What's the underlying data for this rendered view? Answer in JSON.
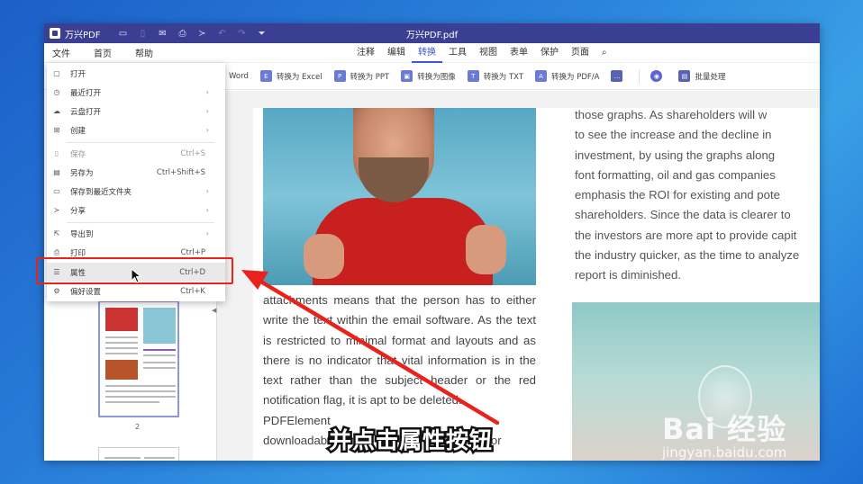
{
  "window": {
    "app_name": "万兴PDF",
    "doc_title": "万兴PDF.pdf"
  },
  "menubar": {
    "left": [
      "文件",
      "首页",
      "帮助"
    ],
    "right": [
      "注释",
      "编辑",
      "转换",
      "工具",
      "视图",
      "表单",
      "保护",
      "页面"
    ],
    "active": "转换"
  },
  "toolbar": {
    "items": [
      {
        "label": "Word",
        "icon": "word-icon"
      },
      {
        "label": "转换为 Excel",
        "icon": "excel-icon"
      },
      {
        "label": "转换为 PPT",
        "icon": "ppt-icon"
      },
      {
        "label": "转换为图像",
        "icon": "image-icon"
      },
      {
        "label": "转换为 TXT",
        "icon": "txt-icon"
      },
      {
        "label": "转换为 PDF/A",
        "icon": "pdfa-icon"
      },
      {
        "label": "",
        "icon": "more-icon"
      },
      {
        "label": "",
        "icon": "ocr-icon"
      },
      {
        "label": "批量处理",
        "icon": "batch-icon"
      }
    ]
  },
  "file_menu": {
    "items": [
      {
        "label": "打开",
        "shortcut": "",
        "submenu": false,
        "icon": "open-file-icon",
        "dim": false
      },
      {
        "label": "最近打开",
        "shortcut": "",
        "submenu": true,
        "icon": "clock-icon",
        "dim": false
      },
      {
        "label": "云盘打开",
        "shortcut": "",
        "submenu": true,
        "icon": "cloud-icon",
        "dim": false
      },
      {
        "label": "创建",
        "shortcut": "",
        "submenu": true,
        "icon": "create-icon",
        "dim": false
      },
      {
        "label": "保存",
        "shortcut": "Ctrl+S",
        "submenu": false,
        "icon": "save-icon",
        "dim": true
      },
      {
        "label": "另存为",
        "shortcut": "Ctrl+Shift+S",
        "submenu": false,
        "icon": "save-as-icon",
        "dim": false
      },
      {
        "label": "保存到最近文件夹",
        "shortcut": "",
        "submenu": true,
        "icon": "folder-icon",
        "dim": false
      },
      {
        "label": "分享",
        "shortcut": "",
        "submenu": true,
        "icon": "share-icon",
        "dim": false
      },
      {
        "label": "导出到",
        "shortcut": "",
        "submenu": true,
        "icon": "export-icon",
        "dim": false
      },
      {
        "label": "打印",
        "shortcut": "Ctrl+P",
        "submenu": false,
        "icon": "print-icon",
        "dim": false
      },
      {
        "label": "属性",
        "shortcut": "Ctrl+D",
        "submenu": false,
        "icon": "properties-icon",
        "dim": false
      },
      {
        "label": "偏好设置",
        "shortcut": "Ctrl+K",
        "submenu": false,
        "icon": "preferences-icon",
        "dim": false
      }
    ]
  },
  "thumbnails": {
    "page_number": "2"
  },
  "document": {
    "left_text": "attachments means that the person has to either write the text within the email software. As the text is restricted to minimal format and layouts and as there is no indicator that vital information is in the text rather than the subject header or the red notification flag, it is apt to be deleted.",
    "left_text_tail": "PDFElement",
    "left_text_tail2": "downloadable format and shared by users for",
    "right_lines": [
      "those graphs. As shareholders will w",
      "to see the increase and the decline in",
      "investment, by using the graphs along",
      "font formatting, oil and gas companies",
      "emphasis the ROI for existing and pote",
      "shareholders. Since the data is clearer to",
      "the investors are more apt to provide capit",
      "the industry quicker, as the time to analyze",
      "report is diminished."
    ]
  },
  "overlay": {
    "caption": "并点击属性按钮",
    "watermark_main": "Bai 经验",
    "watermark_sub": "jingyan.baidu.com",
    "accent_color": "#e8221c"
  }
}
